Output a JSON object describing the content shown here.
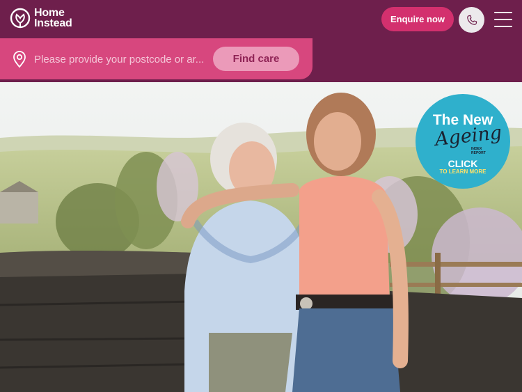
{
  "header": {
    "logo_line1": "Home",
    "logo_line2": "Instead",
    "enquire_label": "Enquire now",
    "phone_icon": "phone-icon",
    "menu_icon": "hamburger-menu-icon"
  },
  "search": {
    "placeholder": "Please provide your postcode or ar...",
    "pin_icon": "location-pin-icon",
    "button_label": "Find care"
  },
  "badge": {
    "line1": "The New",
    "line2": "Ageing",
    "small": "INDEX\nREPORT",
    "cta": "CLICK",
    "sub": "TO LEARN MORE"
  },
  "colors": {
    "brand": "#6e1f4c",
    "accent": "#d3306e",
    "search_bar": "#d7477e",
    "badge": "#2fb0cc"
  }
}
